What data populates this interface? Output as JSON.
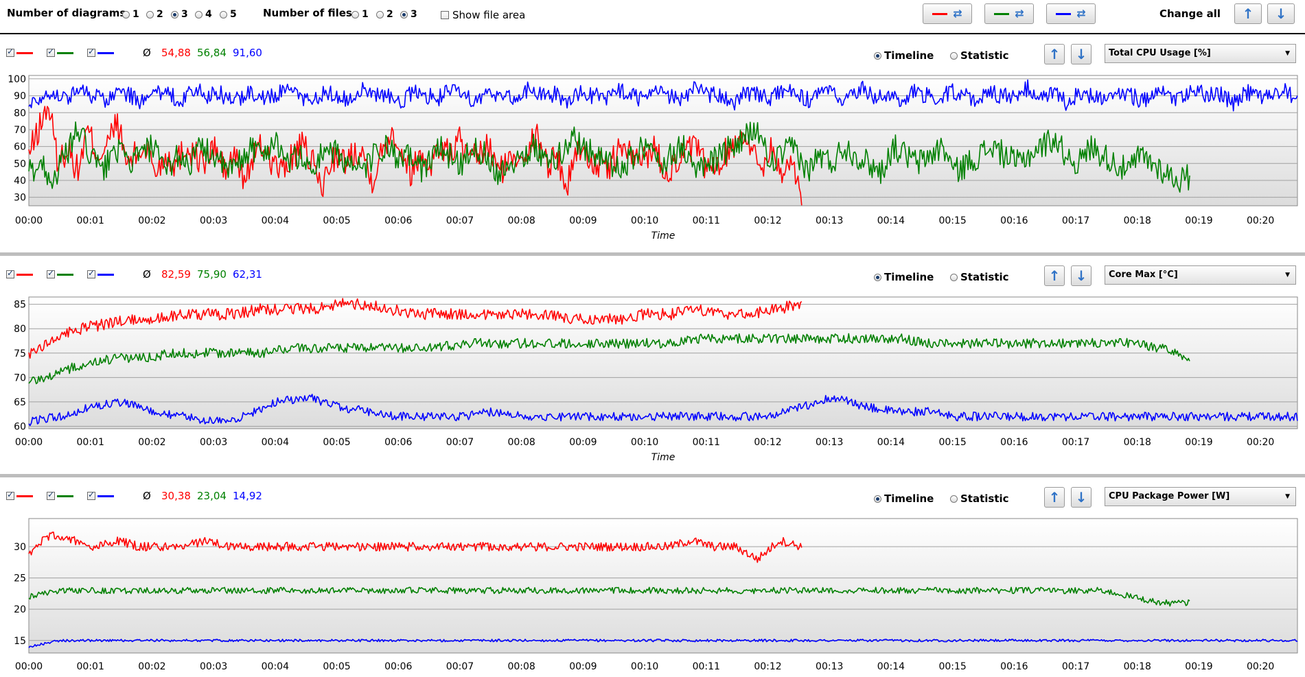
{
  "toolbar": {
    "diagrams_label": "Number of diagrams",
    "diagram_options": [
      "1",
      "2",
      "3",
      "4",
      "5"
    ],
    "diagram_selected": "3",
    "files_label": "Number of files",
    "file_options": [
      "1",
      "2",
      "3"
    ],
    "file_selected": "3",
    "show_file_area": "Show file area",
    "change_all": "Change all"
  },
  "series_colors": [
    "#ff0000",
    "#008000",
    "#0000ff"
  ],
  "radio_timeline": "Timeline",
  "radio_statistic": "Statistic",
  "avg_symbol": "Ø",
  "xaxis_title": "Time",
  "chart_data": [
    {
      "type": "line",
      "metric": "Total CPU Usage [%]",
      "averages": [
        "54,88",
        "56,84",
        "91,60"
      ],
      "xlabel": "Time",
      "x_ticks": [
        "00:00",
        "00:01",
        "00:02",
        "00:03",
        "00:04",
        "00:05",
        "00:06",
        "00:07",
        "00:08",
        "00:09",
        "00:10",
        "00:11",
        "00:12",
        "00:13",
        "00:14",
        "00:15",
        "00:16",
        "00:17",
        "00:18",
        "00:19",
        "00:20"
      ],
      "y_ticks": [
        100,
        90,
        80,
        70,
        60,
        50,
        40,
        30
      ],
      "ylim": [
        25,
        102
      ],
      "xlim_minutes": [
        0,
        20.6
      ],
      "series": [
        {
          "values": [
            55,
            70,
            85,
            50,
            60,
            45,
            70,
            55,
            60,
            75,
            50,
            55,
            60,
            45,
            55,
            50,
            60,
            55,
            50,
            60,
            45,
            55,
            40,
            55,
            60,
            50,
            45,
            55,
            60,
            50,
            35,
            55,
            50,
            55,
            60,
            40,
            55,
            70,
            60,
            45,
            55,
            50,
            60,
            55,
            65,
            50,
            55,
            60,
            45,
            50,
            55,
            60,
            65,
            50,
            55,
            35,
            60,
            55,
            50,
            45,
            55,
            60,
            50,
            55,
            60,
            45,
            50,
            55,
            60,
            50,
            45,
            55,
            60,
            70,
            55,
            50,
            60,
            40,
            55,
            25
          ],
          "x_end": 12.55,
          "noise": 9
        },
        {
          "values": [
            45,
            50,
            40,
            55,
            70,
            55,
            45,
            60,
            50,
            55,
            60,
            45,
            55,
            50,
            60,
            55,
            45,
            50,
            60,
            55,
            65,
            50,
            55,
            45,
            60,
            55,
            50,
            45,
            55,
            60,
            50,
            55,
            45,
            60,
            55,
            50,
            60,
            55,
            45,
            50,
            55,
            60,
            50,
            55,
            65,
            60,
            55,
            50,
            45,
            55,
            60,
            50,
            55,
            60,
            45,
            50,
            55,
            60,
            65,
            70,
            50,
            55,
            60,
            45,
            55,
            50,
            60,
            55,
            50,
            45,
            60,
            55,
            50,
            55,
            60,
            45,
            50,
            55,
            60,
            55,
            50,
            55,
            60,
            65,
            55,
            50,
            60,
            55,
            50,
            45,
            55,
            50,
            45,
            40,
            42
          ],
          "x_end": 18.85,
          "noise": 8
        },
        {
          "values": [
            85,
            90,
            92,
            88,
            95,
            90,
            87,
            93,
            90,
            85,
            92,
            90,
            88,
            94,
            90,
            91,
            86,
            92,
            90,
            89,
            93,
            90,
            87,
            92,
            90,
            88,
            95,
            90,
            91,
            86,
            92,
            90,
            89,
            93,
            90,
            87,
            92,
            90,
            88,
            94,
            90,
            91,
            86,
            92,
            90,
            89,
            93,
            90,
            87,
            92,
            90,
            88,
            95,
            90,
            91,
            86,
            92,
            90,
            89,
            93,
            90,
            87,
            92,
            90,
            88,
            94,
            90,
            91,
            86,
            92,
            90,
            89,
            93,
            90,
            87,
            92,
            90,
            88,
            95,
            90,
            91,
            86,
            92,
            90,
            89,
            93,
            90,
            87,
            92,
            90,
            88,
            94,
            90,
            91,
            86,
            92,
            90,
            89,
            93,
            88
          ],
          "x_end": 20.6,
          "noise": 5
        }
      ]
    },
    {
      "type": "line",
      "metric": "Core Max [°C]",
      "averages": [
        "82,59",
        "75,90",
        "62,31"
      ],
      "xlabel": "Time",
      "x_ticks": [
        "00:00",
        "00:01",
        "00:02",
        "00:03",
        "00:04",
        "00:05",
        "00:06",
        "00:07",
        "00:08",
        "00:09",
        "00:10",
        "00:11",
        "00:12",
        "00:13",
        "00:14",
        "00:15",
        "00:16",
        "00:17",
        "00:18",
        "00:19",
        "00:20"
      ],
      "y_ticks": [
        85,
        80,
        75,
        70,
        65,
        60
      ],
      "ylim": [
        59.5,
        86.5
      ],
      "xlim_minutes": [
        0,
        20.6
      ],
      "series": [
        {
          "values": [
            75,
            78,
            80,
            81,
            82,
            82,
            83,
            83,
            83,
            84,
            84,
            84,
            85,
            85,
            84,
            83,
            83,
            83,
            83,
            83,
            83,
            82,
            82,
            82,
            83,
            83,
            84,
            83,
            83,
            84,
            85
          ],
          "x_end": 12.55,
          "noise": 1.2
        },
        {
          "values": [
            69,
            71,
            73,
            74,
            74,
            75,
            75,
            75,
            75,
            76,
            76,
            76,
            76,
            76,
            76,
            77,
            77,
            77,
            77,
            77,
            77,
            77,
            77,
            78,
            78,
            78,
            78,
            78,
            78,
            78,
            78,
            77,
            77,
            77,
            77,
            77,
            77,
            77,
            77,
            76,
            74
          ],
          "x_end": 18.85,
          "noise": 1.0
        },
        {
          "values": [
            61,
            62,
            64,
            65,
            63,
            62,
            61,
            62,
            65,
            66,
            64,
            63,
            62,
            62,
            62,
            63,
            62,
            62,
            62,
            62,
            62,
            62,
            62,
            62,
            62,
            64,
            66,
            64,
            63,
            63,
            62,
            62,
            62,
            62,
            62,
            62,
            62,
            62,
            62,
            62,
            62,
            62
          ],
          "x_end": 20.6,
          "noise": 0.9
        }
      ]
    },
    {
      "type": "line",
      "metric": "CPU Package Power [W]",
      "averages": [
        "30,38",
        "23,04",
        "14,92"
      ],
      "xlabel": "Time",
      "x_ticks": [
        "00:00",
        "00:01",
        "00:02",
        "00:03",
        "00:04",
        "00:05",
        "00:06",
        "00:07",
        "00:08",
        "00:09",
        "00:10",
        "00:11",
        "00:12",
        "00:13",
        "00:14",
        "00:15",
        "00:16",
        "00:17",
        "00:18",
        "00:19",
        "00:20"
      ],
      "y_ticks": [
        30,
        25,
        20,
        15
      ],
      "ylim": [
        13,
        34.5
      ],
      "xlim_minutes": [
        0,
        20.6
      ],
      "series": [
        {
          "values": [
            29,
            32,
            31,
            30,
            31,
            30,
            30,
            30,
            31,
            30,
            30,
            30,
            30,
            30,
            30,
            30,
            30,
            30,
            30,
            30,
            30,
            30,
            30,
            30,
            30,
            30,
            30,
            30,
            30,
            30,
            31,
            30,
            30,
            28,
            31,
            30
          ],
          "x_end": 12.55,
          "noise": 0.7
        },
        {
          "values": [
            22,
            23,
            23,
            23,
            23,
            23,
            23,
            23,
            23,
            23,
            23,
            23,
            23,
            23,
            23,
            23,
            23,
            23,
            23,
            23,
            23,
            23,
            23,
            23,
            23,
            23,
            23,
            23,
            23,
            23,
            23,
            23,
            23,
            23,
            23,
            23,
            23,
            23,
            22,
            21,
            21
          ],
          "x_end": 18.85,
          "noise": 0.5
        },
        {
          "values": [
            14,
            15,
            15,
            15,
            15,
            15,
            15,
            15,
            15,
            15,
            15,
            15,
            15,
            15,
            15,
            15,
            15,
            15,
            15,
            15,
            15,
            15,
            15,
            15,
            15,
            15,
            15,
            15,
            15,
            15,
            15,
            15,
            15,
            15,
            15,
            15,
            15,
            15,
            15,
            15,
            15,
            15
          ],
          "x_end": 20.6,
          "noise": 0.2
        }
      ]
    }
  ]
}
